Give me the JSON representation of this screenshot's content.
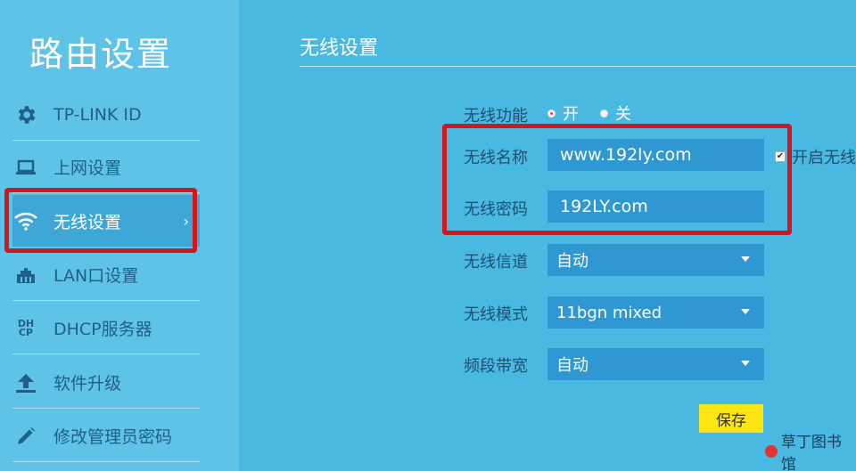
{
  "sidebar": {
    "title": "路由设置",
    "items": [
      {
        "label": "TP-LINK ID",
        "icon": "gear-icon"
      },
      {
        "label": "上网设置",
        "icon": "laptop-icon"
      },
      {
        "label": "无线设置",
        "icon": "wifi-icon",
        "active": true
      },
      {
        "label": "LAN口设置",
        "icon": "lan-icon"
      },
      {
        "label": "DHCP服务器",
        "icon": "dhcp-icon",
        "icon_text": "DHCP"
      },
      {
        "label": "软件升级",
        "icon": "upload-icon"
      },
      {
        "label": "修改管理员密码",
        "icon": "pencil-icon"
      }
    ]
  },
  "main": {
    "title": "无线设置",
    "wireless_function": {
      "label": "无线功能",
      "options": [
        "开",
        "关"
      ],
      "selected": "开"
    },
    "wireless_name": {
      "label": "无线名称",
      "value": "www.192ly.com"
    },
    "wireless_password": {
      "label": "无线密码",
      "value": "192LY.com"
    },
    "enable_checkbox_label": "开启无线",
    "channel": {
      "label": "无线信道",
      "value": "自动"
    },
    "mode": {
      "label": "无线模式",
      "value": "11bgn mixed"
    },
    "bandwidth": {
      "label": "频段带宽",
      "value": "自动"
    },
    "save_label": "保存"
  },
  "watermark": "草丁图书馆",
  "colors": {
    "background": "#4ab9e1",
    "sidebar": "#5fc3e8",
    "input": "#2f98d2",
    "highlight": "#d4161b",
    "save": "#ffe612"
  }
}
